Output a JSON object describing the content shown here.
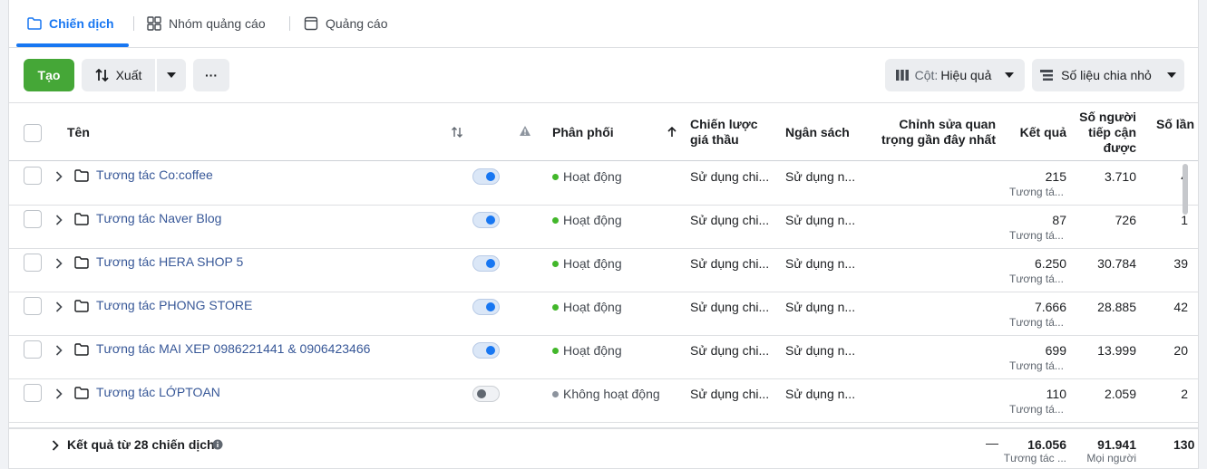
{
  "tabs": [
    {
      "label": "Chiến dịch",
      "icon": "folder-icon",
      "active": true
    },
    {
      "label": "Nhóm quảng cáo",
      "icon": "grid-icon",
      "active": false
    },
    {
      "label": "Quảng cáo",
      "icon": "ad-icon",
      "active": false
    }
  ],
  "toolbar": {
    "create_label": "Tạo",
    "export_label": "Xuất",
    "more_label": "···",
    "columns_prefix": "Cột:",
    "columns_value": "Hiệu quả",
    "breakdown_label": "Số liệu chia nhỏ"
  },
  "columns": {
    "name": "Tên",
    "delivery": "Phân phối",
    "bid_strategy_1": "Chiến lược",
    "bid_strategy_2": "giá thầu",
    "budget": "Ngân sách",
    "recent_edit_1": "Chỉnh sửa quan",
    "recent_edit_2": "trọng gần đây nhất",
    "results": "Kết quả",
    "reach_1": "Số người",
    "reach_2": "tiếp cận",
    "reach_3": "được",
    "impressions": "Số lần"
  },
  "rows": [
    {
      "name": "Tương tác Co:coffee",
      "on": true,
      "delivery": "Hoạt động",
      "bid": "Sử dụng chi...",
      "budget": "Sử dụng n...",
      "results": "215",
      "results_sub": "Tương tá...",
      "reach": "3.710",
      "impressions": "4"
    },
    {
      "name": "Tương tác Naver Blog",
      "on": true,
      "delivery": "Hoạt động",
      "bid": "Sử dụng chi...",
      "budget": "Sử dụng n...",
      "results": "87",
      "results_sub": "Tương tá...",
      "reach": "726",
      "impressions": "1"
    },
    {
      "name": "Tương tác HERA SHOP 5",
      "on": true,
      "delivery": "Hoạt động",
      "bid": "Sử dụng chi...",
      "budget": "Sử dụng n...",
      "results": "6.250",
      "results_sub": "Tương tá...",
      "reach": "30.784",
      "impressions": "39"
    },
    {
      "name": "Tương tác PHONG STORE",
      "on": true,
      "delivery": "Hoạt động",
      "bid": "Sử dụng chi...",
      "budget": "Sử dụng n...",
      "results": "7.666",
      "results_sub": "Tương tá...",
      "reach": "28.885",
      "impressions": "42"
    },
    {
      "name": "Tương tác MAI XEP 0986221441 & 0906423466",
      "on": true,
      "delivery": "Hoạt động",
      "bid": "Sử dụng chi...",
      "budget": "Sử dụng n...",
      "results": "699",
      "results_sub": "Tương tá...",
      "reach": "13.999",
      "impressions": "20"
    },
    {
      "name": "Tương tác LỚPTOAN",
      "on": false,
      "delivery": "Không hoạt động",
      "bid": "Sử dụng chi...",
      "budget": "Sử dụng n...",
      "results": "110",
      "results_sub": "Tương tá...",
      "reach": "2.059",
      "impressions": "2"
    }
  ],
  "footer": {
    "label": "Kết quả từ 28 chiến dịch",
    "edit_dash": "—",
    "results": "16.056",
    "results_sub": "Tương tác ...",
    "reach": "91.941",
    "reach_sub": "Mọi người",
    "impressions": "130"
  },
  "colors": {
    "active_green": "#42b72a",
    "inactive_grey": "#8d949e",
    "link_blue": "#385898",
    "accent_blue": "#1877f2"
  }
}
